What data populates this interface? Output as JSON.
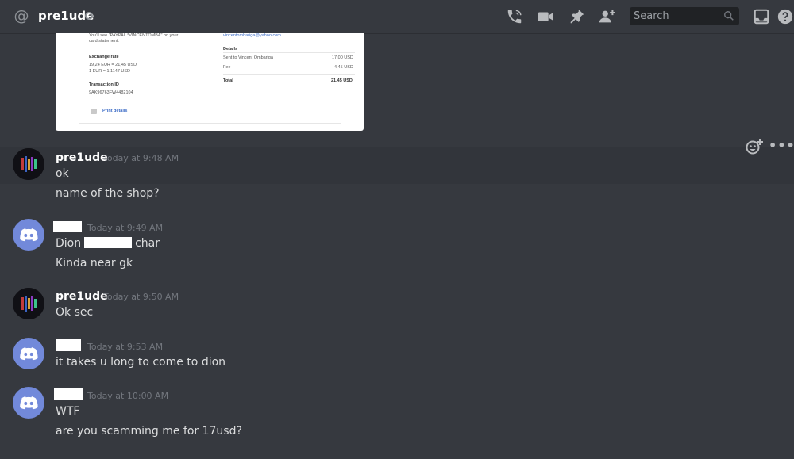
{
  "header": {
    "channel_name": "pre1ude",
    "search_placeholder": "Search",
    "icons": [
      "at-icon",
      "status-icon",
      "call-icon",
      "video-icon",
      "pin-icon",
      "add-friend-icon",
      "search-icon",
      "inbox-icon",
      "help-icon"
    ]
  },
  "embed": {
    "lines": {
      "l1": "You'll see \"PAYPAL *VINCENTOMBA\" on your",
      "l2": "card statement.",
      "rate_label": "Exchange rate",
      "rate1": "19,24 EUR = 21,45 USD",
      "rate2": "1 EUR = 1,1147 USD",
      "txid_label": "Transaction ID",
      "txid": "9AK96763FW4482104",
      "print": "Print details",
      "email": "vincentombariga@yahoo.com",
      "details_label": "Details",
      "sent_label": "Sent to Vincent Ombariga",
      "sent_value": "17,00 USD",
      "fee_label": "Fee",
      "fee_value": "4,45 USD",
      "total_label": "Total",
      "total_value": "21,45 USD"
    }
  },
  "messages": [
    {
      "author": "pre1ude",
      "time": "Today at 9:48 AM",
      "lines": [
        "ok",
        "name of the shop?"
      ]
    },
    {
      "author": "",
      "time": "Today at 9:49 AM",
      "line1_a": "Dion",
      "line1_b": "char",
      "lines": [
        "Kinda near gk"
      ]
    },
    {
      "author": "pre1ude",
      "time": "Today at 9:50 AM",
      "lines": [
        "Ok sec"
      ]
    },
    {
      "author": "",
      "time": "Today at 9:53 AM",
      "lines": [
        "it takes u long to come to dion"
      ]
    },
    {
      "author": "",
      "time": "Today at 10:00 AM",
      "lines": [
        "WTF",
        "are you scamming me for 17usd?"
      ]
    }
  ],
  "colors": {
    "background": "#36393f",
    "blurple": "#7289da",
    "timestamp": "#72767d",
    "text": "#dcddde"
  }
}
